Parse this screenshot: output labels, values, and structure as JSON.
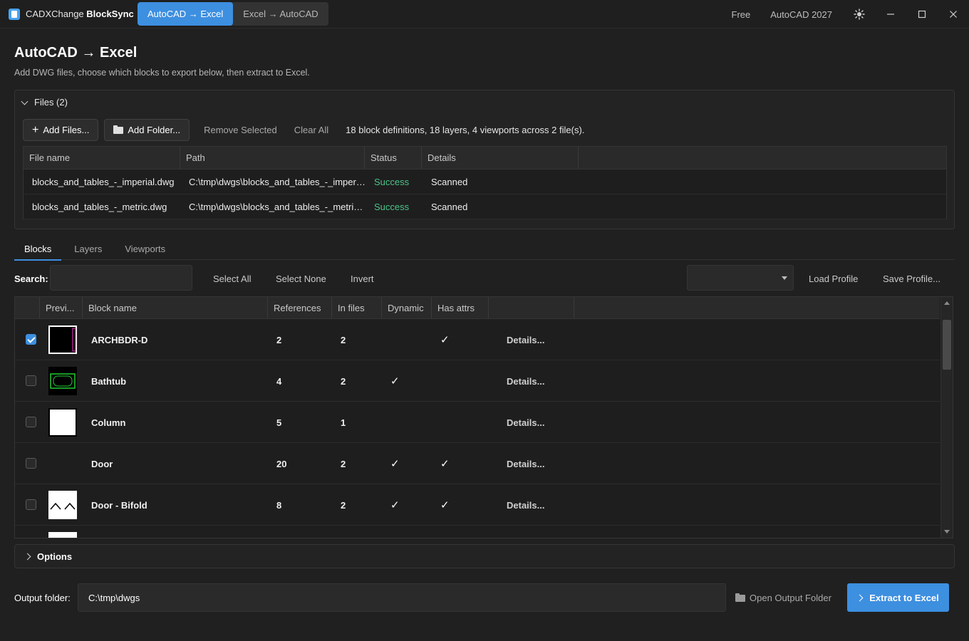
{
  "titlebar": {
    "app_name": "CADXChange",
    "app_name_bold": "BlockSync",
    "mode_tabs": [
      "AutoCAD → Excel",
      "Excel → AutoCAD"
    ],
    "plan": "Free",
    "version": "AutoCAD 2027",
    "icons": [
      "theme-icon",
      "minimize-icon",
      "maximize-icon",
      "close-icon"
    ]
  },
  "header": {
    "title": "AutoCAD → Excel",
    "subtitle": "Add DWG files, choose which blocks to export below, then extract to Excel."
  },
  "files": {
    "heading": "Files (2)",
    "add_files": "Add Files...",
    "add_folder": "Add Folder...",
    "remove_selected": "Remove Selected",
    "clear_all": "Clear All",
    "summary": "18 block definitions, 18 layers, 4 viewports across 2 file(s).",
    "columns": [
      "File name",
      "Path",
      "Status",
      "Details"
    ],
    "rows": [
      {
        "name": "blocks_and_tables_-_imperial.dwg",
        "path": "C:\\tmp\\dwgs\\blocks_and_tables_-_imperi...",
        "status": "Success",
        "details": "Scanned"
      },
      {
        "name": "blocks_and_tables_-_metric.dwg",
        "path": "C:\\tmp\\dwgs\\blocks_and_tables_-_metric....",
        "status": "Success",
        "details": "Scanned"
      }
    ]
  },
  "tabs": [
    "Blocks",
    "Layers",
    "Viewports"
  ],
  "search": {
    "label": "Search:",
    "value": "",
    "select_all": "Select All",
    "select_none": "Select None",
    "invert": "Invert",
    "profile_value": "",
    "load_profile": "Load Profile",
    "save_profile": "Save Profile..."
  },
  "blocks": {
    "columns": [
      "Previ...",
      "Block name",
      "References",
      "In files",
      "Dynamic",
      "Has attrs"
    ],
    "check_mark": "✓",
    "rows": [
      {
        "checked": true,
        "name": "ARCHBDR-D",
        "references": "2",
        "in_files": "2",
        "dynamic": false,
        "has_attrs": true,
        "details": "Details...",
        "preview": "border"
      },
      {
        "checked": false,
        "name": "Bathtub",
        "references": "4",
        "in_files": "2",
        "dynamic": true,
        "has_attrs": false,
        "details": "Details...",
        "preview": "bathtub"
      },
      {
        "checked": false,
        "name": "Column",
        "references": "5",
        "in_files": "1",
        "dynamic": false,
        "has_attrs": false,
        "details": "Details...",
        "preview": "white"
      },
      {
        "checked": false,
        "name": "Door",
        "references": "20",
        "in_files": "2",
        "dynamic": true,
        "has_attrs": true,
        "details": "Details...",
        "preview": "none"
      },
      {
        "checked": false,
        "name": "Door - Bifold",
        "references": "8",
        "in_files": "2",
        "dynamic": true,
        "has_attrs": true,
        "details": "Details...",
        "preview": "bifold"
      }
    ]
  },
  "options": {
    "label": "Options"
  },
  "footer": {
    "output_label": "Output folder:",
    "output_value": "C:\\tmp\\dwgs",
    "open_folder": "Open Output Folder",
    "extract": "Extract to Excel"
  },
  "colors": {
    "accent": "#3d8fe0",
    "success": "#4cc38a",
    "background": "#202020"
  }
}
